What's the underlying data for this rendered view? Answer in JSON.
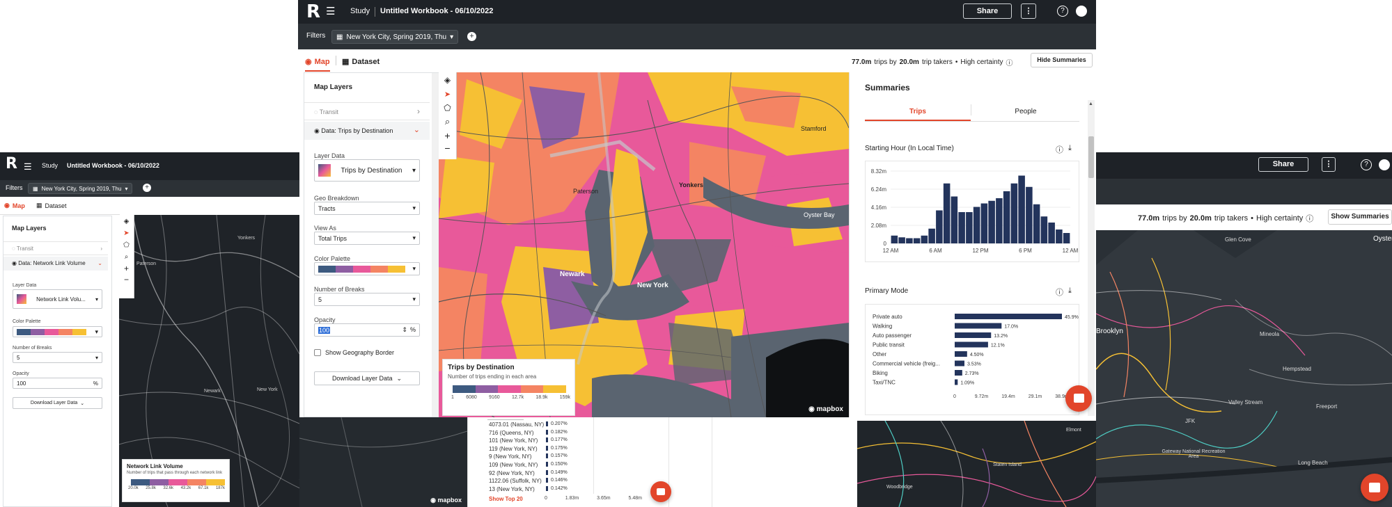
{
  "app": {
    "brand_letter": "R",
    "study_label": "Study",
    "workbook_title": "Untitled Workbook - 06/10/2022",
    "share_label": "Share",
    "more_label": "⋮",
    "help_icon": "?",
    "filters_label": "Filters",
    "filter_value": "New York City, Spring 2019, Thu"
  },
  "main": {
    "tabs": [
      {
        "label": "Map"
      },
      {
        "label": "Dataset"
      }
    ],
    "stats": {
      "trips": "77.0m",
      "trips_by": "trips by",
      "takers": "20.0m",
      "takers_suffix": "trip takers",
      "certainty": "High certainty"
    },
    "hide_summaries": "Hide Summaries",
    "map_layers_title": "Map Layers",
    "transit_label": "Transit",
    "data_layer_label": "Data: Trips by Destination",
    "layer_data_label": "Layer Data",
    "layer_data_value": "Trips by Destination",
    "geo_label": "Geo Breakdown",
    "geo_value": "Tracts",
    "view_label": "View As",
    "view_value": "Total Trips",
    "palette_label": "Color Palette",
    "breaks_label": "Number of Breaks",
    "breaks_value": "5",
    "opacity_label": "Opacity",
    "opacity_value": "100",
    "percent": "%",
    "border_label": "Show Geography Border",
    "download_label": "Download Layer Data",
    "legend_title": "Trips by Destination",
    "legend_sub": "Number of trips ending in each area",
    "legend_ticks": [
      "1",
      "6080",
      "9160",
      "12.7k",
      "18.9k",
      "159k"
    ],
    "palette_colors": [
      "#3d5a80",
      "#8e5ea2",
      "#e8599a",
      "#f48463",
      "#f6c034"
    ],
    "mapbox": "mapbox",
    "map_places": [
      "Yonkers",
      "Stamford",
      "Paterson",
      "Newark",
      "New York",
      "Oyster Bay"
    ]
  },
  "summaries": {
    "title": "Summaries",
    "tabs": [
      "Trips",
      "People"
    ],
    "starting_hour_title": "Starting Hour (In Local Time)",
    "y_ticks": [
      "8.32m",
      "6.24m",
      "4.16m",
      "2.08m",
      "0"
    ],
    "x_ticks": [
      "12 AM",
      "6 AM",
      "12 PM",
      "6 PM",
      "12 AM"
    ],
    "primary_mode_title": "Primary Mode",
    "mode_x_ticks": [
      "0",
      "9.72m",
      "19.4m",
      "29.1m",
      "38.9m"
    ]
  },
  "chart_data": [
    {
      "type": "bar",
      "title": "Starting Hour (In Local Time)",
      "categories": [
        "0",
        "1",
        "2",
        "3",
        "4",
        "5",
        "6",
        "7",
        "8",
        "9",
        "10",
        "11",
        "12",
        "13",
        "14",
        "15",
        "16",
        "17",
        "18",
        "19",
        "20",
        "21",
        "22",
        "23"
      ],
      "values": [
        0.9,
        0.7,
        0.6,
        0.6,
        0.9,
        1.7,
        3.8,
        6.9,
        5.4,
        3.6,
        3.6,
        4.2,
        4.6,
        4.9,
        5.2,
        6.0,
        6.9,
        7.8,
        6.5,
        4.5,
        3.1,
        2.4,
        1.6,
        1.2
      ],
      "xlabel": "",
      "ylabel": "",
      "ylim": [
        0,
        8.32
      ]
    },
    {
      "type": "bar",
      "title": "Primary Mode",
      "categories": [
        "Private auto",
        "Walking",
        "Auto passenger",
        "Public transit",
        "Other",
        "Commercial vehicle (freig...",
        "Biking",
        "Taxi/TNC"
      ],
      "values": [
        45.9,
        17.0,
        13.2,
        12.1,
        4.5,
        3.53,
        2.73,
        1.09
      ],
      "labels": [
        "45.9%",
        "17.0%",
        "13.2%",
        "12.1%",
        "4.50%",
        "3.53%",
        "2.73%",
        "1.09%"
      ],
      "xlim": [
        0,
        38.9
      ]
    }
  ],
  "left": {
    "tabs": [
      {
        "label": "Map"
      },
      {
        "label": "Dataset"
      }
    ],
    "map_layers_title": "Map Layers",
    "transit_label": "Transit",
    "data_layer_label": "Data: Network Link Volume",
    "layer_data_label": "Layer Data",
    "layer_data_value": "Network Link Volu...",
    "palette_label": "Color Palette",
    "breaks_label": "Number of Breaks",
    "breaks_value": "5",
    "opacity_label": "Opacity",
    "opacity_value": "100",
    "download_label": "Download Layer Data",
    "legend_title": "Network Link Volume",
    "legend_sub": "Number of trips that pass through each network link",
    "legend_ticks": [
      "20.0k",
      "25.8k",
      "32.6k",
      "43.2k",
      "67.1k",
      "187k"
    ],
    "palette_colors": [
      "#3d5a80",
      "#8e5ea2",
      "#e8599a",
      "#f48463",
      "#f6c034"
    ],
    "places": [
      "Paterson",
      "Yonkers",
      "New York",
      "Newark"
    ]
  },
  "right": {
    "stats_trips": "77.0m",
    "stats_takers": "20.0m",
    "stats_rest": "trip takers",
    "certainty": "High certainty",
    "show_summaries": "Show Summaries",
    "places": [
      "Glen Cove",
      "Oyster",
      "Mineola",
      "Hempstead",
      "Valley Stream",
      "Freeport",
      "JFK",
      "Long Beach",
      "Gateway National Recreation Area",
      "Staten Island",
      "Woodbridge",
      "Elmont",
      "Brooklyn"
    ]
  },
  "underlay": {
    "rows": [
      {
        "label": "4073.01 (Nassau, NY)",
        "value": "0.207%"
      },
      {
        "label": "716 (Queens, NY)",
        "value": "0.182%"
      },
      {
        "label": "101 (New York, NY)",
        "value": "0.177%"
      },
      {
        "label": "119 (New York, NY)",
        "value": "0.175%"
      },
      {
        "label": "9 (New York, NY)",
        "value": "0.157%"
      },
      {
        "label": "109 (New York, NY)",
        "value": "0.150%"
      },
      {
        "label": "92 (New York, NY)",
        "value": "0.149%"
      },
      {
        "label": "1122.06 (Suffolk, NY)",
        "value": "0.146%"
      },
      {
        "label": "13 (New York, NY)",
        "value": "0.142%"
      }
    ],
    "show_top": "Show Top 20",
    "x_ticks": [
      "0",
      "1.83m",
      "3.65m",
      "5.48m"
    ]
  }
}
